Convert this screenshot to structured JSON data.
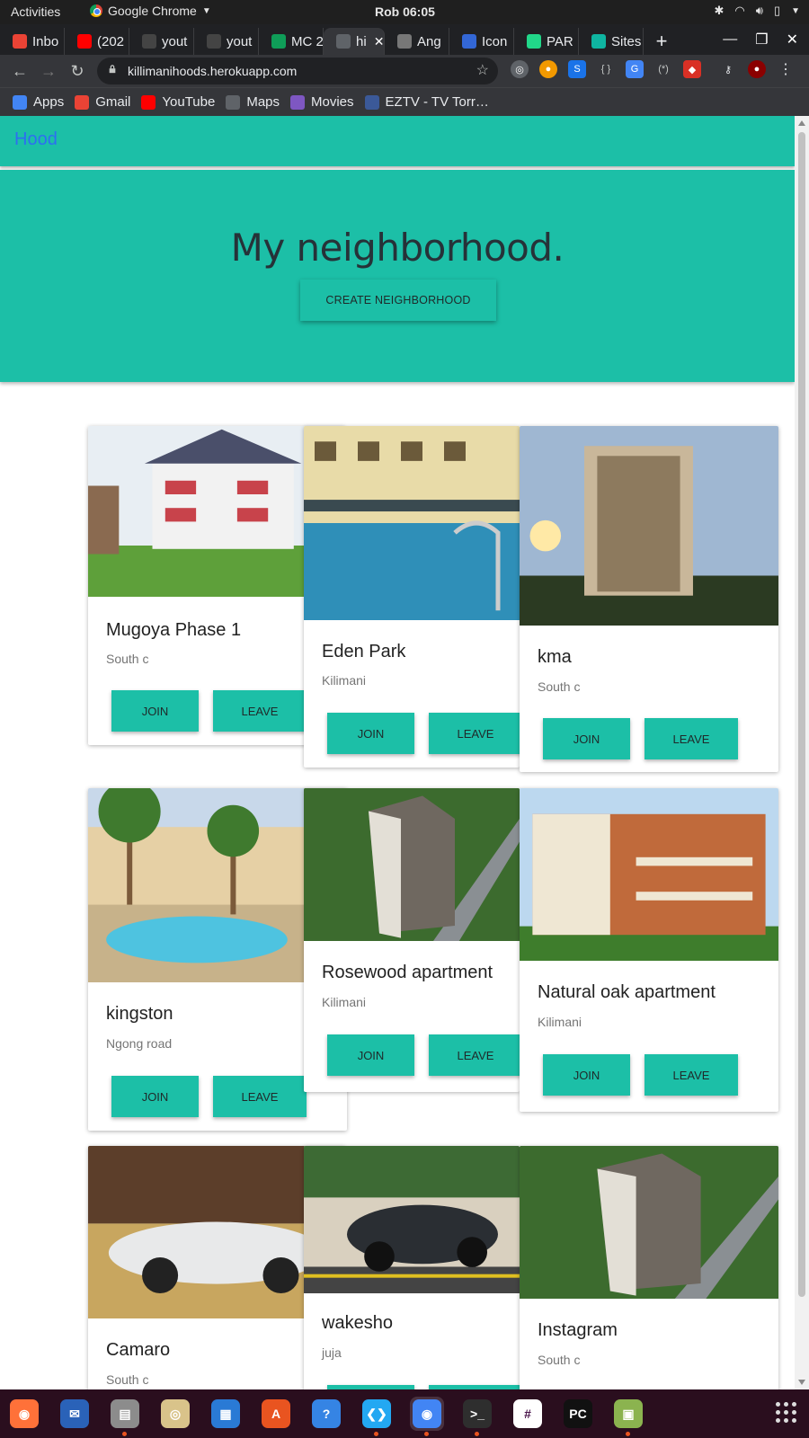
{
  "system": {
    "activities": "Activities",
    "app_menu": "Google Chrome",
    "clock": "Rob 06:05"
  },
  "tabs": [
    {
      "label": "Inbo",
      "icon": "gmail-icon",
      "color": "#ea4335"
    },
    {
      "label": "(202",
      "icon": "youtube-icon",
      "color": "#ff0000"
    },
    {
      "label": "yout",
      "icon": "github-icon",
      "color": "#444444"
    },
    {
      "label": "yout",
      "icon": "github-icon",
      "color": "#444444"
    },
    {
      "label": "MC 2",
      "icon": "sheets-plus-icon",
      "color": "#0f9d58"
    },
    {
      "label": "hi",
      "icon": "globe-icon",
      "color": "#5f6368",
      "active": true
    },
    {
      "label": "Ang",
      "icon": "avatar-icon",
      "color": "#777777"
    },
    {
      "label": "Icon",
      "icon": "flag-icon",
      "color": "#3367d6"
    },
    {
      "label": "PAR",
      "icon": "pc-icon",
      "color": "#21d789"
    },
    {
      "label": "Sites",
      "icon": "diamond-icon",
      "color": "#0fb5a1"
    }
  ],
  "omnibox": {
    "url": "killimanihoods.herokuapp.com"
  },
  "bookmarks": [
    {
      "label": "Apps",
      "icon": "apps-grid-icon"
    },
    {
      "label": "Gmail",
      "icon": "gmail-icon"
    },
    {
      "label": "YouTube",
      "icon": "youtube-icon"
    },
    {
      "label": "Maps",
      "icon": "globe-icon"
    },
    {
      "label": "Movies",
      "icon": "movies-icon"
    },
    {
      "label": "EZTV - TV Torr…",
      "icon": "eztv-icon"
    }
  ],
  "page": {
    "brand": "Hood",
    "hero_title": "My neighborhood.",
    "create_button": "CREATE NEIGHBORHOOD",
    "join_label": "JOIN",
    "leave_label": "LEAVE",
    "accent": "#1cbfa7"
  },
  "neighborhoods": [
    {
      "name": "Mugoya Phase 1",
      "location": "South c",
      "image": "apartment-building-photo"
    },
    {
      "name": "Eden Park",
      "location": "Kilimani",
      "image": "pool-apartments-photo"
    },
    {
      "name": "kma",
      "location": "South c",
      "image": "tower-sunset-photo"
    },
    {
      "name": "kingston",
      "location": "Ngong road",
      "image": "resort-pool-photo"
    },
    {
      "name": "Rosewood apartment",
      "location": "Kilimani",
      "image": "tower-aerial-photo"
    },
    {
      "name": "Natural oak apartment",
      "location": "Kilimani",
      "image": "brick-apartment-photo"
    },
    {
      "name": "Camaro",
      "location": "South c",
      "image": "white-supercar-photo"
    },
    {
      "name": "wakesho",
      "location": "juja",
      "image": "black-mustang-photo"
    },
    {
      "name": "Instagram",
      "location": "South c",
      "image": "tower-aerial-photo"
    }
  ],
  "dock": [
    {
      "name": "firefox-icon"
    },
    {
      "name": "thunderbird-icon"
    },
    {
      "name": "files-icon"
    },
    {
      "name": "rhythmbox-icon"
    },
    {
      "name": "writer-icon"
    },
    {
      "name": "software-icon"
    },
    {
      "name": "help-icon"
    },
    {
      "name": "vscode-icon"
    },
    {
      "name": "chrome-icon"
    },
    {
      "name": "terminal-icon"
    },
    {
      "name": "slack-icon"
    },
    {
      "name": "pycharm-icon"
    },
    {
      "name": "image-viewer-icon"
    }
  ]
}
